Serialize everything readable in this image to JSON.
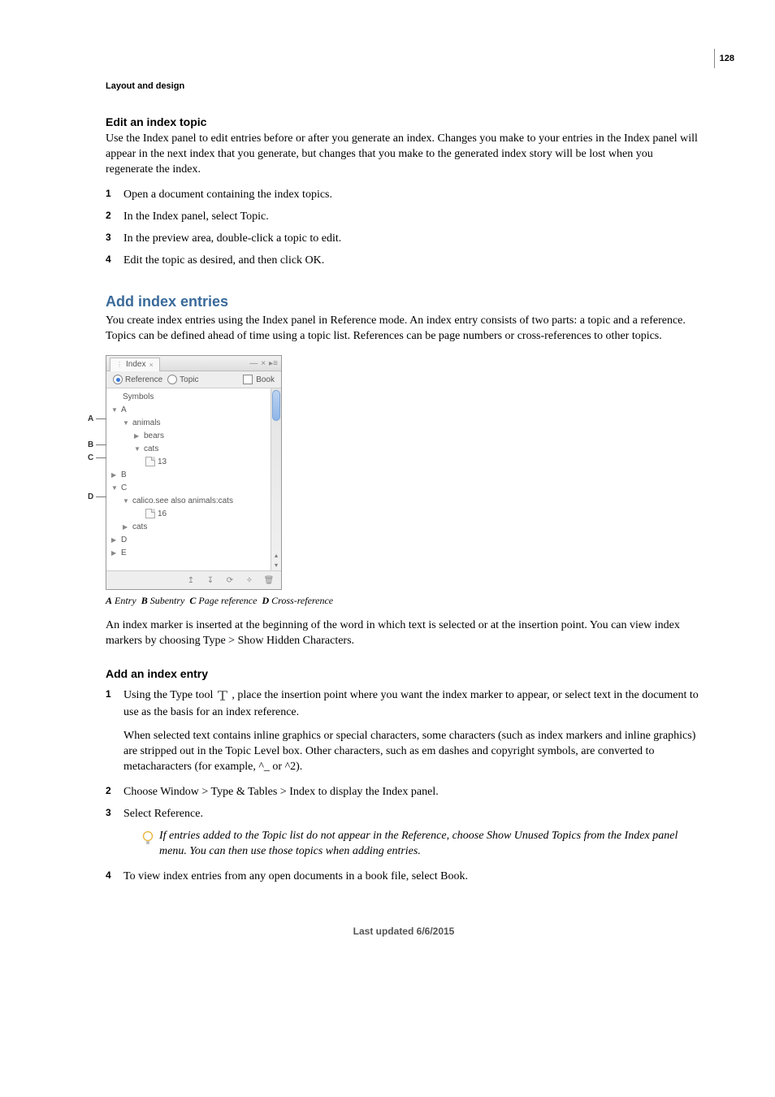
{
  "page_number": "128",
  "chapter": "Layout and design",
  "sec1": {
    "heading": "Edit an index topic",
    "intro": "Use the Index panel to edit entries before or after you generate an index. Changes you make to your entries in the Index panel will appear in the next index that you generate, but changes that you make to the generated index story will be lost when you regenerate the index.",
    "steps": [
      "Open a document containing the index topics.",
      "In the Index panel, select Topic.",
      "In the preview area, double-click a topic to edit.",
      "Edit the topic as desired, and then click OK."
    ]
  },
  "sec2": {
    "heading": "Add index entries",
    "intro": "You create index entries using the Index panel in Reference mode. An index entry consists of two parts: a topic and a reference. Topics can be defined ahead of time using a topic list. References can be page numbers or cross-references to other topics."
  },
  "panel": {
    "tab": "Index",
    "mode_reference": "Reference",
    "mode_topic": "Topic",
    "book": "Book",
    "rows": {
      "symbols": "Symbols",
      "A": "A",
      "animals": "animals",
      "bears": "bears",
      "cats_sub": "cats",
      "page13": "13",
      "B": "B",
      "C": "C",
      "calico": "calico.see also animals:cats",
      "page16": "16",
      "cats": "cats",
      "D": "D",
      "E": "E"
    }
  },
  "caption": {
    "A": "A",
    "A_txt": "Entry",
    "B": "B",
    "B_txt": "Subentry",
    "C": "C",
    "C_txt": "Page reference",
    "D": "D",
    "D_txt": "Cross-reference"
  },
  "after_figure": "An index marker is inserted at the beginning of the word in which text is selected or at the insertion point. You can view index markers by choosing Type > Show Hidden Characters.",
  "sec3": {
    "heading": "Add an index entry",
    "step1a": "Using the Type tool ",
    "step1b": " , place the insertion point where you want the index marker to appear, or select text in the document to use as the basis for an index reference.",
    "step1_sub": "When selected text contains inline graphics or special characters, some characters (such as index markers and inline graphics) are stripped out in the Topic Level box. Other characters, such as em dashes and copyright symbols, are converted to metacharacters (for example, ^_ or ^2).",
    "step2": "Choose Window > Type & Tables > Index to display the Index panel.",
    "step3": "Select Reference.",
    "tip": "If entries added to the Topic list do not appear in the Reference, choose Show Unused Topics from the Index panel menu. You can then use those topics when adding entries.",
    "step4": "To view index entries from any open documents in a book file, select Book."
  },
  "footer": "Last updated 6/6/2015",
  "nums": {
    "n1": "1",
    "n2": "2",
    "n3": "3",
    "n4": "4"
  },
  "callouts": {
    "A": "A",
    "B": "B",
    "C": "C",
    "D": "D"
  }
}
